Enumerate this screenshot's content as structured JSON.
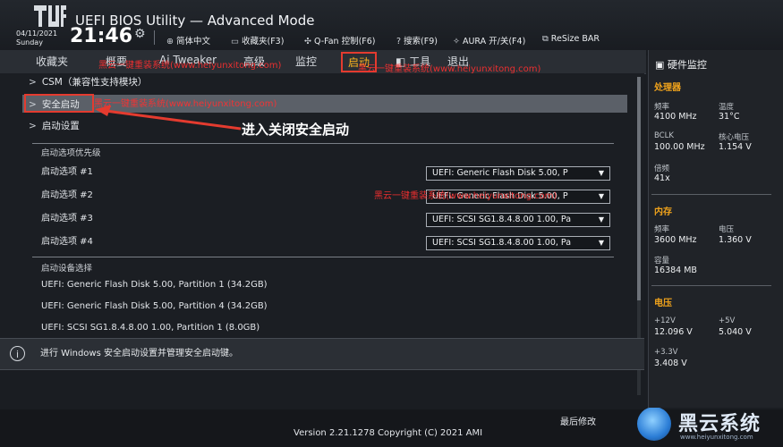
{
  "header": {
    "title": "UEFI BIOS Utility — Advanced Mode",
    "date": "04/11/2021",
    "weekday": "Sunday",
    "time": "21:46",
    "toolbar": [
      {
        "icon": "globe-icon",
        "glyph": "⊕",
        "label": "简体中文"
      },
      {
        "icon": "favorites-icon",
        "glyph": "▭",
        "label": "收藏夹(F3)"
      },
      {
        "icon": "fan-icon",
        "glyph": "✣",
        "label": "Q-Fan 控制(F6)"
      },
      {
        "icon": "search-icon",
        "glyph": "?",
        "label": "搜索(F9)"
      },
      {
        "icon": "aura-icon",
        "glyph": "✧",
        "label": "AURA 开/关(F4)"
      },
      {
        "icon": "resize-bar-icon",
        "glyph": "⧉",
        "label": "ReSize BAR"
      }
    ]
  },
  "tabs": {
    "favorites": "收藏夹",
    "main": "概要",
    "ai_tweaker": "Ai Tweaker",
    "advanced": "高级",
    "monitor": "监控",
    "boot": "启动",
    "tool": "工具",
    "exit": "退出"
  },
  "menu": {
    "csm": "CSM（兼容性支持模块）",
    "secure_boot": "安全启动",
    "boot_config": "启动设置"
  },
  "boot_priority": {
    "heading": "启动选项优先级",
    "options": [
      {
        "label": "启动选项 #1",
        "value": "UEFI: Generic Flash Disk 5.00, P"
      },
      {
        "label": "启动选项 #2",
        "value": "UEFI: Generic Flash Disk 5.00, P"
      },
      {
        "label": "启动选项 #3",
        "value": "UEFI: SCSI SG1.8.4.8.00 1.00, Pa"
      },
      {
        "label": "启动选项 #4",
        "value": "UEFI: SCSI SG1.8.4.8.00 1.00, Pa"
      }
    ]
  },
  "boot_devices": {
    "heading": "启动设备选择",
    "items": [
      "UEFI: Generic Flash Disk 5.00, Partition 1 (34.2GB)",
      "UEFI: Generic Flash Disk 5.00, Partition 4 (34.2GB)",
      "UEFI: SCSI SG1.8.4.8.00 1.00, Partition 1 (8.0GB)"
    ]
  },
  "annotation": "进入关闭安全启动",
  "help_text": "进行 Windows 安全启动设置并管理安全启动键。",
  "footer": {
    "version": "Version 2.21.1278 Copyright (C) 2021 AMI",
    "last_modified": "最后修改"
  },
  "brand": {
    "name": "黑云系统",
    "url": "www.heiyunxitong.com"
  },
  "hardware_monitor": {
    "title": "硬件监控",
    "cpu": {
      "heading": "处理器",
      "freq_label": "频率",
      "freq": "4100 MHz",
      "temp_label": "温度",
      "temp": "31°C",
      "bclk_label": "BCLK",
      "bclk": "100.00 MHz",
      "vcore_label": "核心电压",
      "vcore": "1.154 V",
      "ratio_label": "倍频",
      "ratio": "41x"
    },
    "memory": {
      "heading": "内存",
      "freq_label": "频率",
      "freq": "3600 MHz",
      "volt_label": "电压",
      "volt": "1.360 V",
      "cap_label": "容量",
      "cap": "16384 MB"
    },
    "voltage": {
      "heading": "电压",
      "v12_label": "+12V",
      "v12": "12.096 V",
      "v5_label": "+5V",
      "v5": "5.040 V",
      "v33_label": "+3.3V",
      "v33": "3.408 V"
    }
  },
  "watermarks": [
    "黑云一键重装系统(www.heiyunxitong.com)",
    "黑云一键重装系统(www.heiyunxitong.com)",
    "黑云一键重装系统(www.heiyunxitong.com)",
    "黑云一键重装系统(www.heiyunxitong.com)"
  ],
  "colors": {
    "accent": "#ffb61e",
    "highlight_box": "#e43b2f",
    "section_heading": "#f0a31c"
  }
}
